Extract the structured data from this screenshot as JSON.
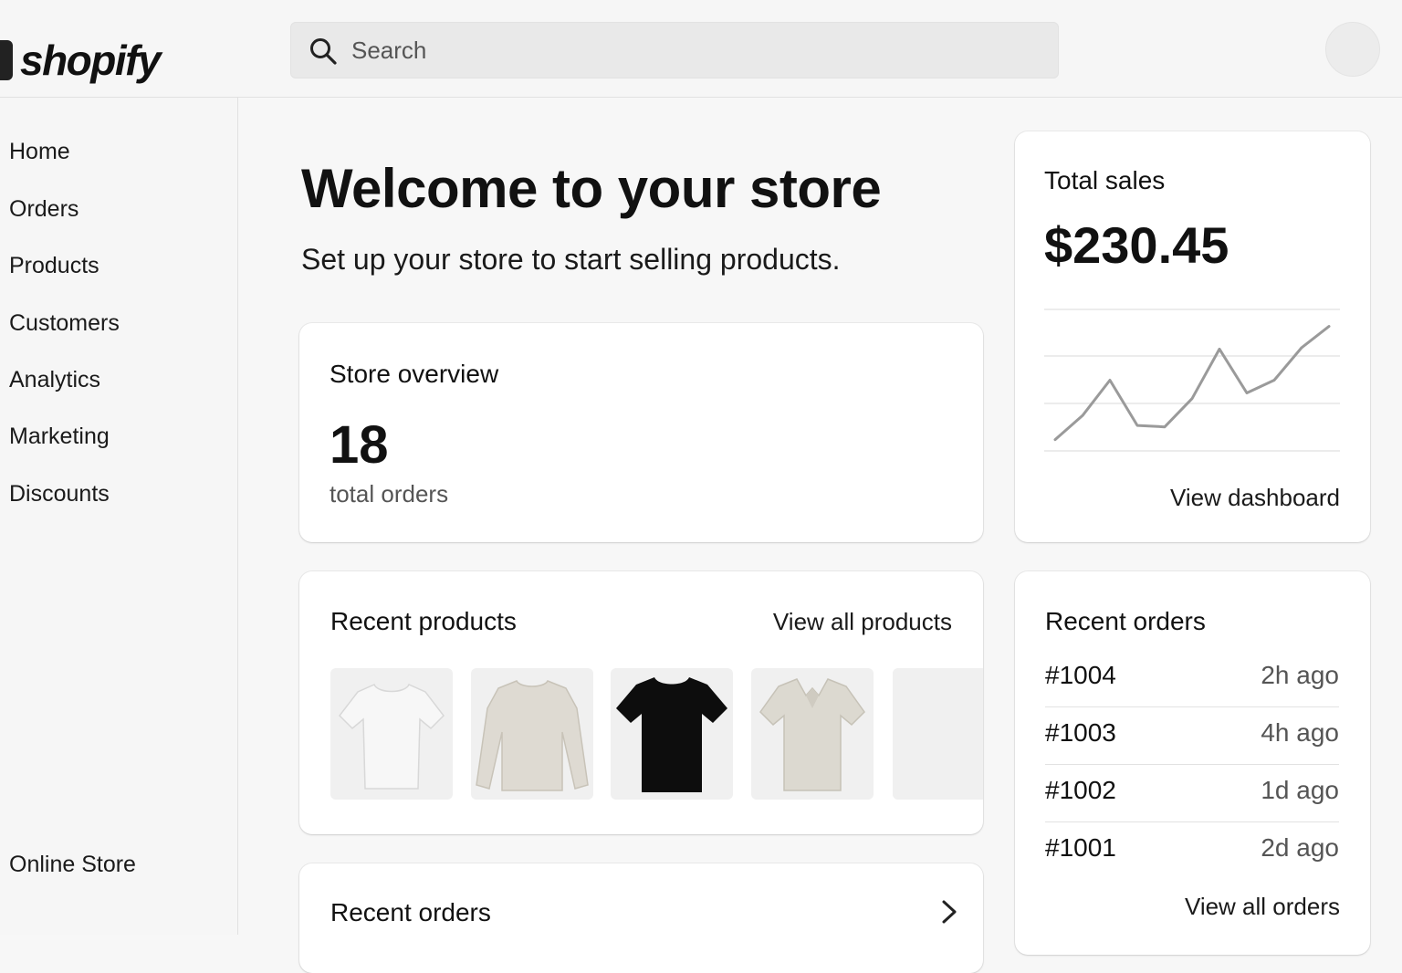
{
  "brand": {
    "name": "shopify"
  },
  "search": {
    "placeholder": "Search"
  },
  "sidebar": {
    "items": [
      {
        "label": "Home"
      },
      {
        "label": "Orders"
      },
      {
        "label": "Products"
      },
      {
        "label": "Customers"
      },
      {
        "label": "Analytics"
      },
      {
        "label": "Marketing"
      },
      {
        "label": "Discounts"
      }
    ],
    "bottom_item": {
      "label": "Online Store"
    }
  },
  "main": {
    "title": "Welcome to your store",
    "subtitle": "Set up your store to start selling products."
  },
  "overview": {
    "title": "Store overview",
    "value": "18",
    "caption": "total orders"
  },
  "sales": {
    "title": "Total sales",
    "amount": "$230.45",
    "link": "View dashboard",
    "trend": [
      0.08,
      0.25,
      0.5,
      0.18,
      0.17,
      0.37,
      0.72,
      0.41,
      0.5,
      0.73,
      0.88
    ],
    "line_color": "#9a9a9a"
  },
  "products": {
    "title": "Recent products",
    "link": "View all products",
    "items": [
      {
        "icon": "white-tshirt-icon",
        "color": "#f4f4f4"
      },
      {
        "icon": "beige-sweater-icon",
        "color": "#dedad2"
      },
      {
        "icon": "black-tshirt-icon",
        "color": "#0d0d0d"
      },
      {
        "icon": "beige-polo-shirt-icon",
        "color": "#dcd9d0"
      },
      {
        "icon": "placeholder-image-icon",
        "color": "#f0f0f0"
      }
    ]
  },
  "recent_orders": {
    "title": "Recent orders",
    "link": "View all orders",
    "rows": [
      {
        "id": "#1004",
        "time": "2h ago"
      },
      {
        "id": "#1003",
        "time": "4h ago"
      },
      {
        "id": "#1002",
        "time": "1d ago"
      },
      {
        "id": "#1001",
        "time": "2d ago"
      }
    ]
  },
  "recent_orders_panel": {
    "title": "Recent orders"
  }
}
